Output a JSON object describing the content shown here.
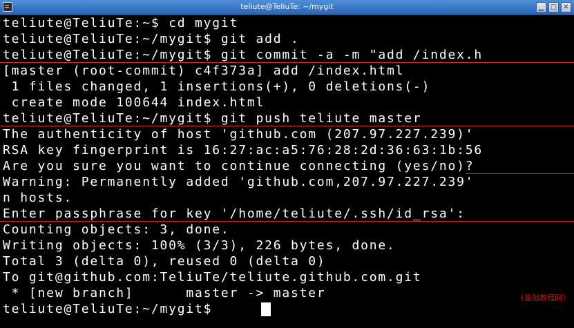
{
  "window": {
    "title": "teliute@TeliuTe: ~/mygit",
    "minimize_glyph": "▁",
    "maximize_glyph": "□",
    "close_glyph": "✕"
  },
  "terminal": {
    "lines": [
      "teliute@TeliuTe:~$ cd mygit",
      "teliute@TeliuTe:~/mygit$ git add .",
      "teliute@TeliuTe:~/mygit$ git commit -a -m \"add /index.h",
      "[master (root-commit) c4f373a] add /index.html",
      " 1 files changed, 1 insertions(+), 0 deletions(-)",
      " create mode 100644 index.html",
      "teliute@TeliuTe:~/mygit$ git push teliute master",
      "The authenticity of host 'github.com (207.97.227.239)'",
      "RSA key fingerprint is 16:27:ac:a5:76:28:2d:36:63:1b:56",
      "Are you sure you want to continue connecting (yes/no)?",
      "Warning: Permanently added 'github.com,207.97.227.239'",
      "n hosts.",
      "Enter passphrase for key '/home/teliute/.ssh/id_rsa':",
      "Counting objects: 3, done.",
      "Writing objects: 100% (3/3), 226 bytes, done.",
      "Total 3 (delta 0), reused 0 (delta 0)",
      "To git@github.com:TeliuTe/teliute.github.com.git",
      " * [new branch]      master -> master",
      "teliute@TeliuTe:~/mygit$ "
    ],
    "watermark": "《基础教程网》"
  },
  "colors": {
    "background": "#000000",
    "text": "#ffffff",
    "annotation": "#e02020",
    "titlebar": "#2a63b8"
  }
}
